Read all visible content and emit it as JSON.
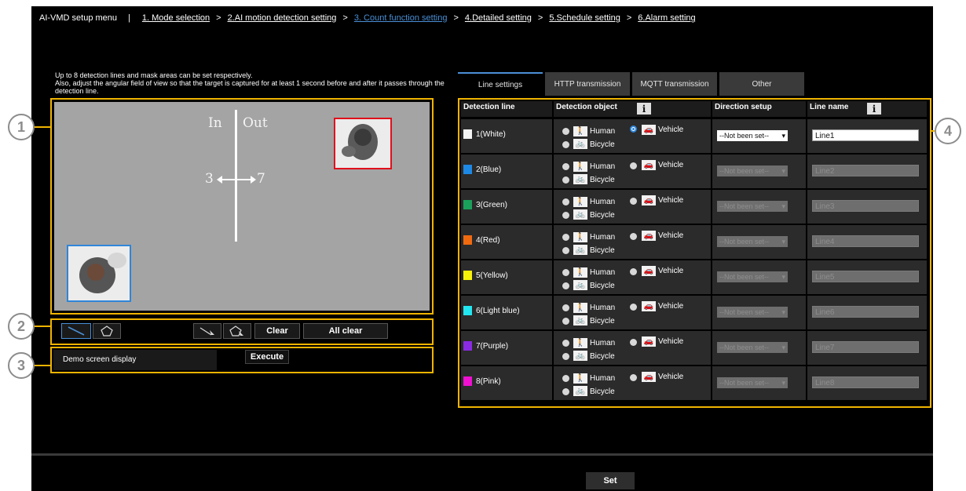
{
  "nav": {
    "menu_title": "AI-VMD setup menu",
    "separator": "|",
    "steps": [
      "1. Mode selection",
      "2.AI motion detection setting",
      "3. Count function setting",
      "4.Detailed setting",
      "5.Schedule setting",
      "6.Alarm setting"
    ],
    "arrow": ">",
    "active_step_index": 2,
    "active_color": "#4a8fd6"
  },
  "intro": {
    "line1": "Up to 8 detection lines and mask areas can be set respectively.",
    "line2": "Also, adjust the angular field of view so that the target is captured for at least 1 second before and after it passes through the detection line."
  },
  "camera": {
    "label_in": "In",
    "label_out": "Out",
    "label_left": "3",
    "label_right": "7"
  },
  "toolbar": {
    "line_tool_icon": "line-draw-icon",
    "area_tool_icon": "pentagon-area-icon",
    "delete_line_icon": "erase-line-icon",
    "delete_area_icon": "erase-area-icon",
    "clear_label": "Clear",
    "all_clear_label": "All clear"
  },
  "demo": {
    "label": "Demo screen display",
    "execute_label": "Execute"
  },
  "callouts": [
    "1",
    "2",
    "3",
    "4"
  ],
  "tabs": [
    {
      "label": "Line settings",
      "active": true
    },
    {
      "label": "HTTP transmission",
      "active": false
    },
    {
      "label": "MQTT transmission",
      "active": false
    },
    {
      "label": "Other",
      "active": false
    }
  ],
  "table": {
    "headers": {
      "detection_line": "Detection line",
      "detection_object": "Detection object",
      "direction_setup": "Direction setup",
      "line_name": "Line name"
    },
    "info_symbol": "i",
    "option_human": "Human",
    "option_vehicle": "Vehicle",
    "option_bicycle": "Bicycle",
    "rows": [
      {
        "label": "1(White)",
        "color": "#f4f4f4",
        "selected": "vehicle",
        "direction": "--Not been set--",
        "name": "Line1",
        "enabled": true
      },
      {
        "label": "2(Blue)",
        "color": "#1e88e5",
        "selected": "",
        "direction": "--Not been set--",
        "name": "Line2",
        "enabled": false
      },
      {
        "label": "3(Green)",
        "color": "#1aa05a",
        "selected": "",
        "direction": "--Not been set--",
        "name": "Line3",
        "enabled": false
      },
      {
        "label": "4(Red)",
        "color": "#f06a10",
        "selected": "",
        "direction": "--Not been set--",
        "name": "Line4",
        "enabled": false
      },
      {
        "label": "5(Yellow)",
        "color": "#f6f20a",
        "selected": "",
        "direction": "--Not been set--",
        "name": "Line5",
        "enabled": false
      },
      {
        "label": "6(Light blue)",
        "color": "#22e6f0",
        "selected": "",
        "direction": "--Not been set--",
        "name": "Line6",
        "enabled": false
      },
      {
        "label": "7(Purple)",
        "color": "#8a2be2",
        "selected": "",
        "direction": "--Not been set--",
        "name": "Line7",
        "enabled": false
      },
      {
        "label": "8(Pink)",
        "color": "#f010d0",
        "selected": "",
        "direction": "--Not been set--",
        "name": "Line8",
        "enabled": false
      }
    ]
  },
  "footer": {
    "set_label": "Set"
  },
  "colors": {
    "highlight": "#f0b400",
    "background": "#000000"
  }
}
